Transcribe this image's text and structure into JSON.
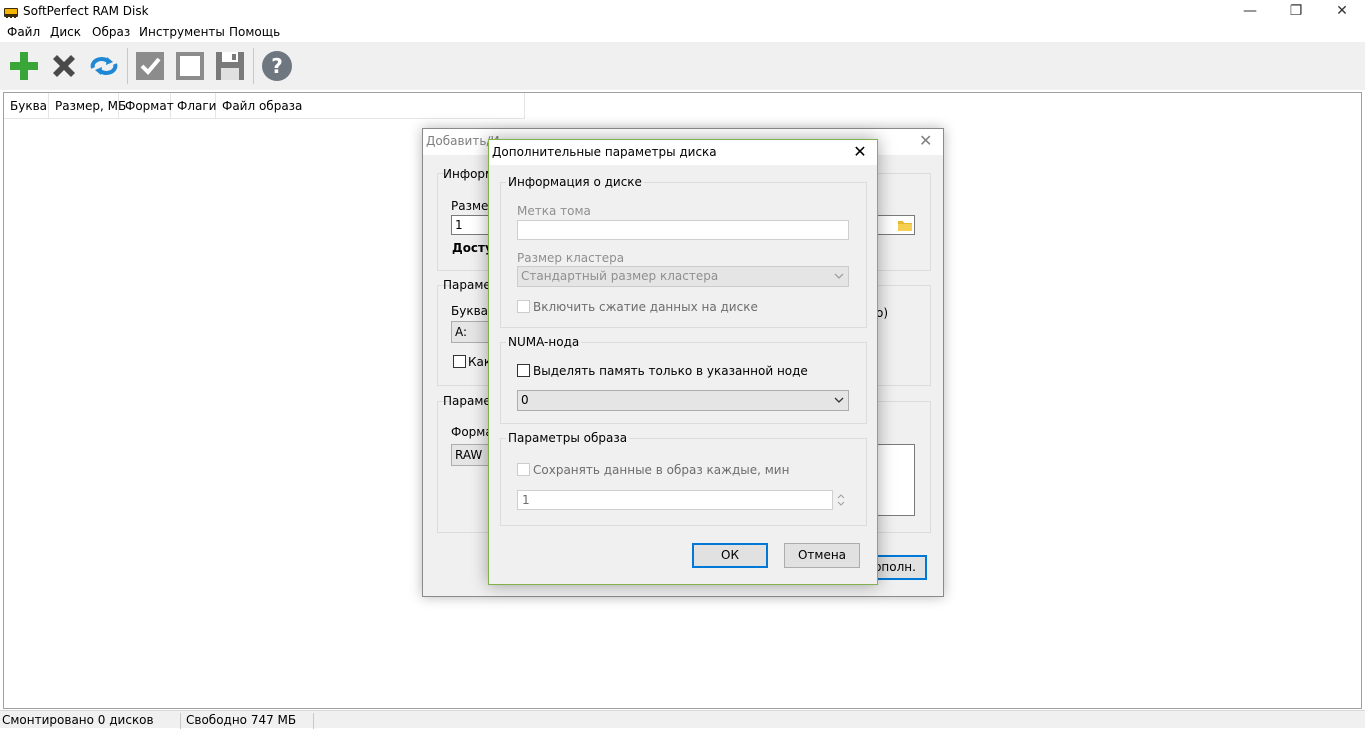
{
  "window": {
    "title": "SoftPerfect RAM Disk",
    "minimize_glyph": "—",
    "restore_glyph": "❐",
    "close_glyph": "✕"
  },
  "menu": [
    "Файл",
    "Диск",
    "Образ",
    "Инструменты",
    "Помощь"
  ],
  "toolbar": {
    "icons": [
      "add-icon",
      "remove-icon",
      "refresh-icon",
      "mount-check-icon",
      "unmount-square-icon",
      "save-floppy-icon",
      "help-icon"
    ]
  },
  "list": {
    "columns": [
      "Буква",
      "Размер, МБ",
      "Формат",
      "Флаги",
      "Файл образа"
    ]
  },
  "status": {
    "mounted": "Смонтировано 0 дисков",
    "free": "Свободно 747 МБ"
  },
  "bg_dialog": {
    "title_partial": "Добавить/И",
    "info_label": "Информа",
    "size_label": "Размер,",
    "size_value": "1",
    "available_label": "Досту",
    "params_label": "Параметр",
    "letter_label": "Буква д",
    "letter_value": "A:",
    "as_label": "Как",
    "params2_label": "Парамет",
    "format_label": "Формат",
    "format_value": "RAW",
    "tail_text": "о)",
    "advanced_btn": "ополн."
  },
  "dialog": {
    "title": "Дополнительные параметры диска",
    "disk_info": {
      "legend": "Информация о диске",
      "volume_label": "Метка тома",
      "volume_value": "",
      "cluster_label": "Размер кластера",
      "cluster_value": "Стандартный размер кластера",
      "compress_label": "Включить сжатие данных на диске"
    },
    "numa": {
      "legend": "NUMA-нода",
      "alloc_label": "Выделять память только в указанной ноде",
      "node_value": "0"
    },
    "image": {
      "legend": "Параметры образа",
      "save_label": "Сохранять данные в образ каждые, мин",
      "interval_value": "1"
    },
    "ok": "ОК",
    "cancel": "Отмена"
  }
}
